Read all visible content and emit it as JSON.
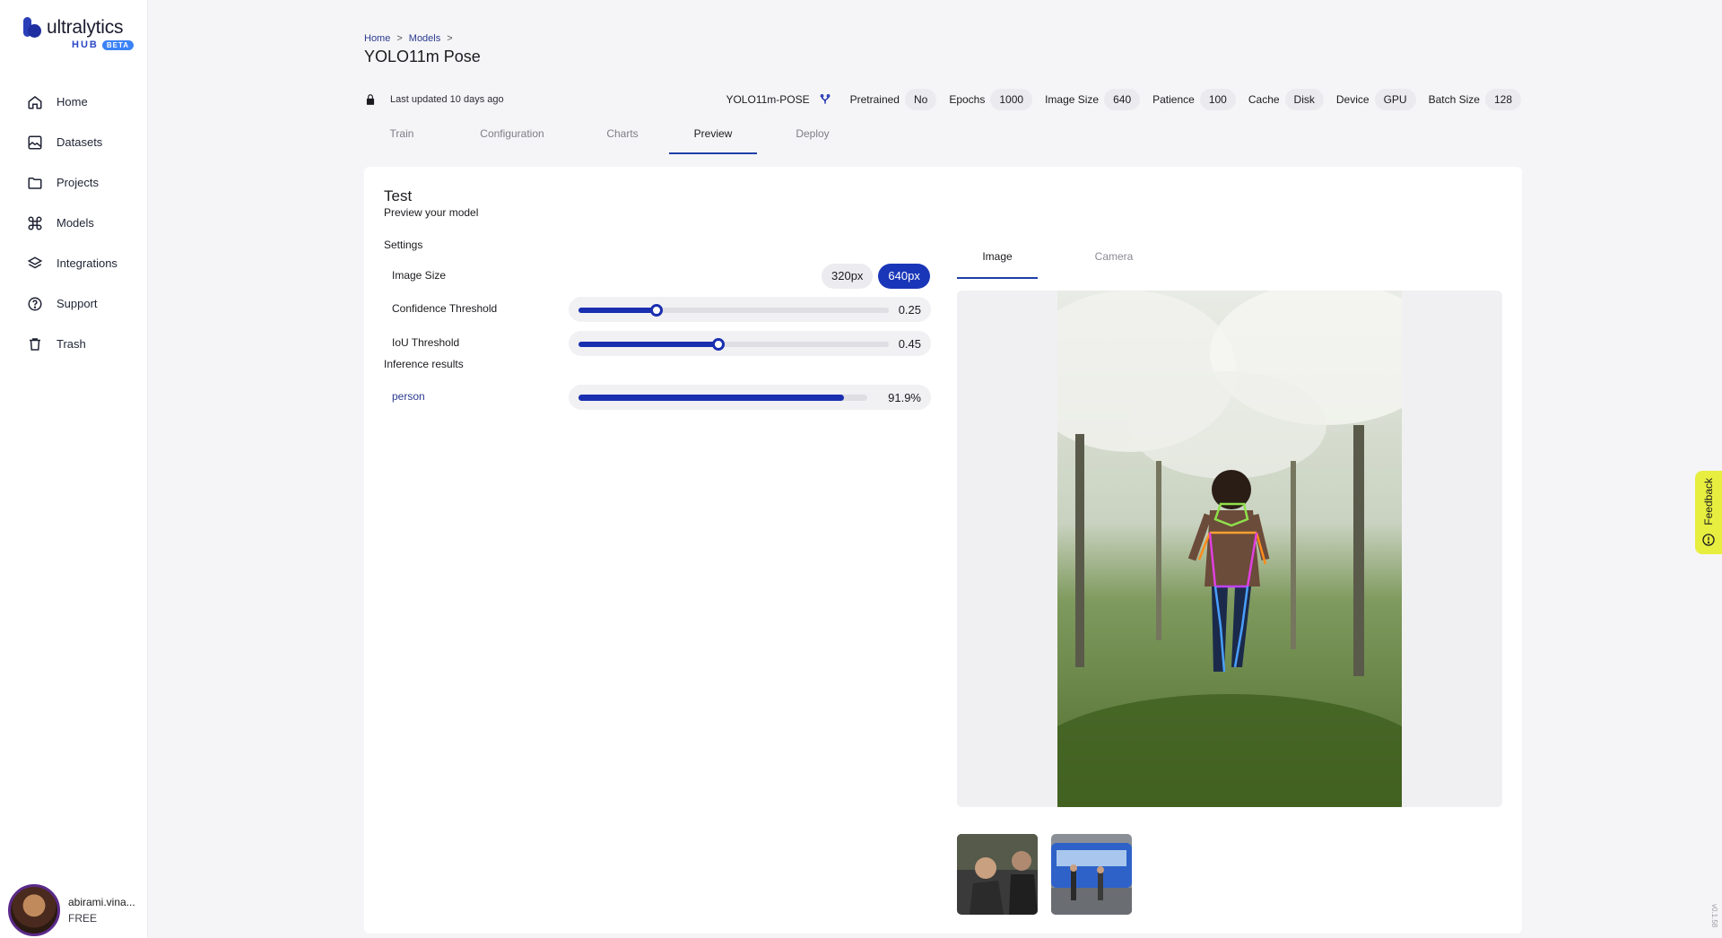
{
  "brand": {
    "name": "ultralytics",
    "hub": "HUB",
    "badge": "BETA"
  },
  "sidebar": {
    "items": [
      {
        "label": "Home",
        "icon": "home-icon"
      },
      {
        "label": "Datasets",
        "icon": "image-icon"
      },
      {
        "label": "Projects",
        "icon": "folder-icon"
      },
      {
        "label": "Models",
        "icon": "command-icon"
      },
      {
        "label": "Integrations",
        "icon": "layers-icon"
      },
      {
        "label": "Support",
        "icon": "help-circle-icon"
      },
      {
        "label": "Trash",
        "icon": "trash-icon"
      }
    ]
  },
  "user": {
    "name": "abirami.vina...",
    "plan": "FREE"
  },
  "breadcrumb": {
    "home": "Home",
    "models": "Models",
    "sep": ">"
  },
  "page": {
    "title": "YOLO11m Pose",
    "last_updated": "Last updated 10 days ago"
  },
  "model": {
    "name": "YOLO11m-POSE",
    "params": [
      {
        "key": "Pretrained",
        "value": "No"
      },
      {
        "key": "Epochs",
        "value": "1000"
      },
      {
        "key": "Image Size",
        "value": "640"
      },
      {
        "key": "Patience",
        "value": "100"
      },
      {
        "key": "Cache",
        "value": "Disk"
      },
      {
        "key": "Device",
        "value": "GPU"
      },
      {
        "key": "Batch Size",
        "value": "128"
      }
    ]
  },
  "tabs": [
    {
      "label": "Train",
      "active": false
    },
    {
      "label": "Configuration",
      "active": false
    },
    {
      "label": "Charts",
      "active": false
    },
    {
      "label": "Preview",
      "active": true
    },
    {
      "label": "Deploy",
      "active": false
    }
  ],
  "test": {
    "title": "Test",
    "subtitle": "Preview your model",
    "settings_label": "Settings",
    "image_size": {
      "label": "Image Size",
      "options": [
        "320px",
        "640px"
      ],
      "selected": "640px"
    },
    "confidence": {
      "label": "Confidence Threshold",
      "value": 0.25,
      "display": "0.25"
    },
    "iou": {
      "label": "IoU Threshold",
      "value": 0.45,
      "display": "0.45"
    },
    "results_label": "Inference results",
    "results": [
      {
        "label": "person",
        "value": 0.919,
        "display": "91.9%"
      }
    ]
  },
  "viewer": {
    "tabs": [
      {
        "label": "Image",
        "active": true
      },
      {
        "label": "Camera",
        "active": false
      }
    ]
  },
  "feedback": {
    "label": "Feedback"
  },
  "version": "v0.1.58",
  "colors": {
    "accent": "#1a2fb0",
    "feedback": "#e7ee3f"
  }
}
